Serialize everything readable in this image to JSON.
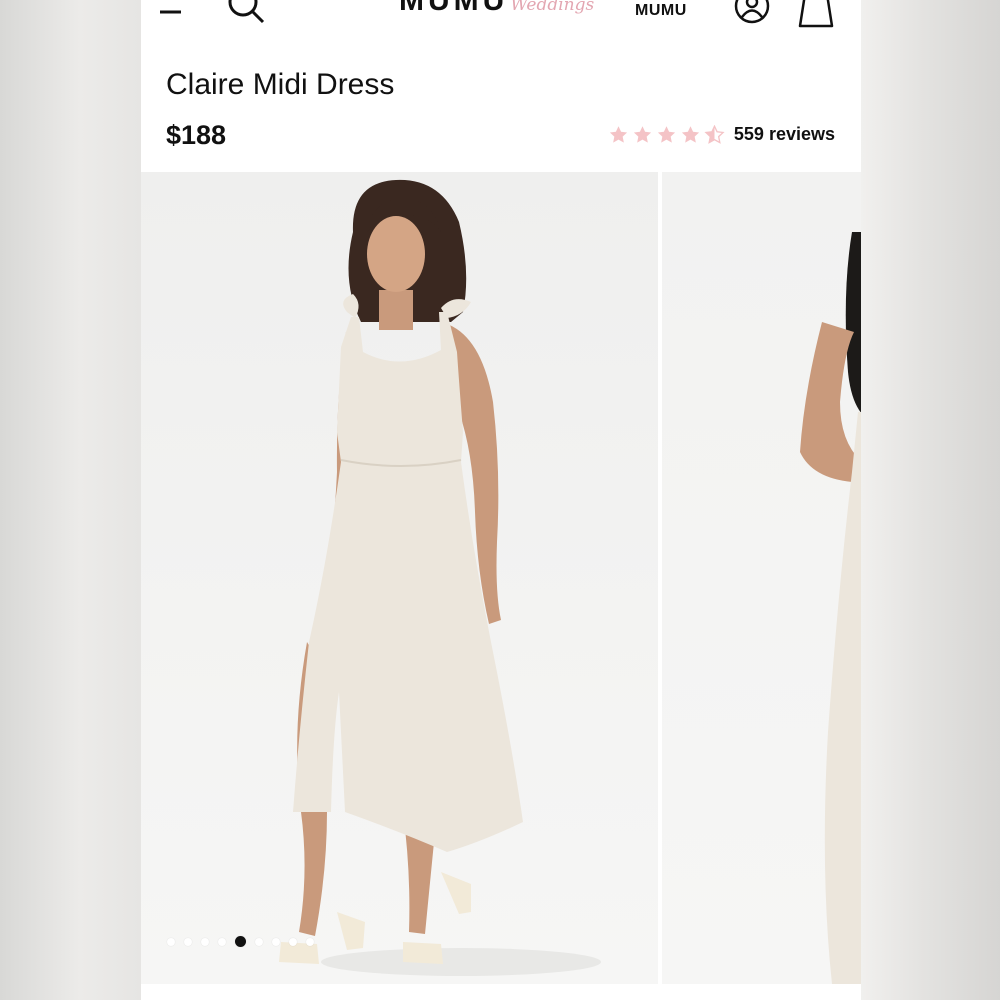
{
  "header": {
    "brand": "MUMU",
    "brand_sub": "Weddings",
    "show_me_label": "MUMU",
    "icons": [
      "menu-icon",
      "search-icon",
      "account-icon",
      "bag-icon"
    ]
  },
  "product": {
    "title": "Claire Midi Dress",
    "price": "$188",
    "rating": 4.5,
    "rating_max": 5,
    "reviews": "559 reviews"
  },
  "gallery": {
    "dot_count": 9,
    "active_dot": 4
  },
  "colors": {
    "star": "#f4c3c6",
    "brand_accent": "#e3a6b1",
    "dress": "#ece6dc",
    "text": "#111111"
  }
}
